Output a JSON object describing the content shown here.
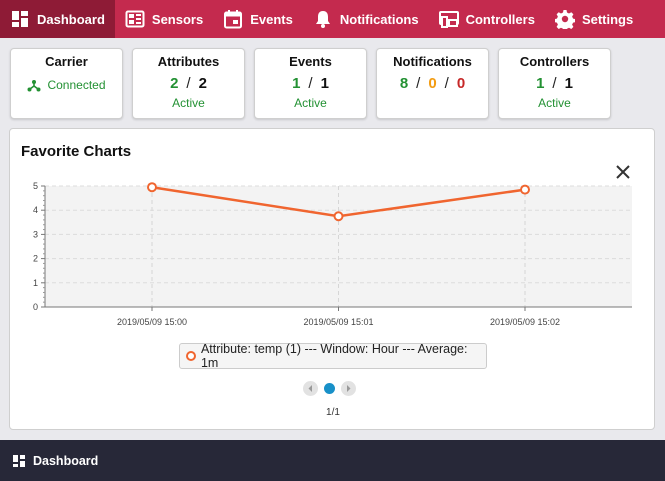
{
  "nav": {
    "items": [
      {
        "label": "Dashboard",
        "icon": "dashboard-icon",
        "active": true
      },
      {
        "label": "Sensors",
        "icon": "sensors-icon"
      },
      {
        "label": "Events",
        "icon": "calendar-icon"
      },
      {
        "label": "Notifications",
        "icon": "bell-icon"
      },
      {
        "label": "Controllers",
        "icon": "controllers-icon"
      },
      {
        "label": "Settings",
        "icon": "gear-icon"
      }
    ],
    "accent_color": "#c42a4e",
    "active_color": "#8e1b36"
  },
  "cards": {
    "carrier": {
      "title": "Carrier",
      "status": "Connected",
      "icon": "network-icon"
    },
    "attributes": {
      "title": "Attributes",
      "active": "2",
      "total": "2",
      "sub": "Active"
    },
    "events": {
      "title": "Events",
      "active": "1",
      "total": "1",
      "sub": "Active"
    },
    "notifications": {
      "title": "Notifications",
      "a": "8",
      "b": "0",
      "c": "0"
    },
    "controllers": {
      "title": "Controllers",
      "active": "1",
      "total": "1",
      "sub": "Active"
    },
    "separator": "/"
  },
  "favorites": {
    "title": "Favorite Charts",
    "pager_text": "1/1"
  },
  "chart_data": {
    "type": "line",
    "x": [
      "2019/05/09 15:00",
      "2019/05/09 15:01",
      "2019/05/09 15:02"
    ],
    "series": [
      {
        "name": "Attribute: temp (1) --- Window: Hour --- Average: 1m",
        "values": [
          4.95,
          3.75,
          4.85
        ],
        "color": "#f0652f"
      }
    ],
    "ylim": [
      0,
      5
    ],
    "yticks": [
      "0",
      "1",
      "2",
      "3",
      "4",
      "5"
    ],
    "grid": true,
    "legend_position": "bottom"
  },
  "footer": {
    "label": "Dashboard",
    "icon": "dashboard-icon"
  }
}
